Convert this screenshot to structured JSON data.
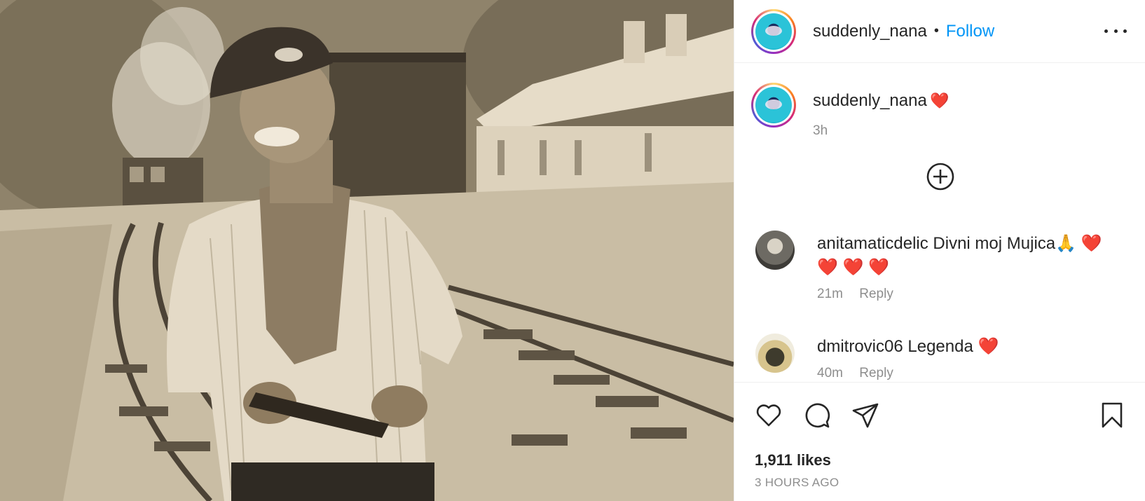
{
  "post": {
    "author": "suddenly_nana",
    "follow_label": "Follow",
    "separator": "•",
    "caption_emoji": "❤️",
    "caption_time": "3h",
    "likes": "1,911 likes",
    "posted_ago": "3 HOURS AGO"
  },
  "comments": [
    {
      "user": "anitamaticdelic",
      "text_line1": "Divni moj Mujica🙏 ❤️",
      "text_line2": "❤️ ❤️ ❤️",
      "time": "21m",
      "reply_label": "Reply"
    },
    {
      "user": "dmitrovic06",
      "text_line1": "Legenda ❤️",
      "time": "40m",
      "reply_label": "Reply"
    }
  ],
  "icons": {
    "more": "more-options-icon",
    "add": "add-circle-icon",
    "like": "heart-icon",
    "comment": "comment-icon",
    "share": "send-icon",
    "save": "bookmark-icon"
  },
  "colors": {
    "link": "#0095f6",
    "heart": "#e0245e",
    "muted": "#8e8e8e"
  }
}
